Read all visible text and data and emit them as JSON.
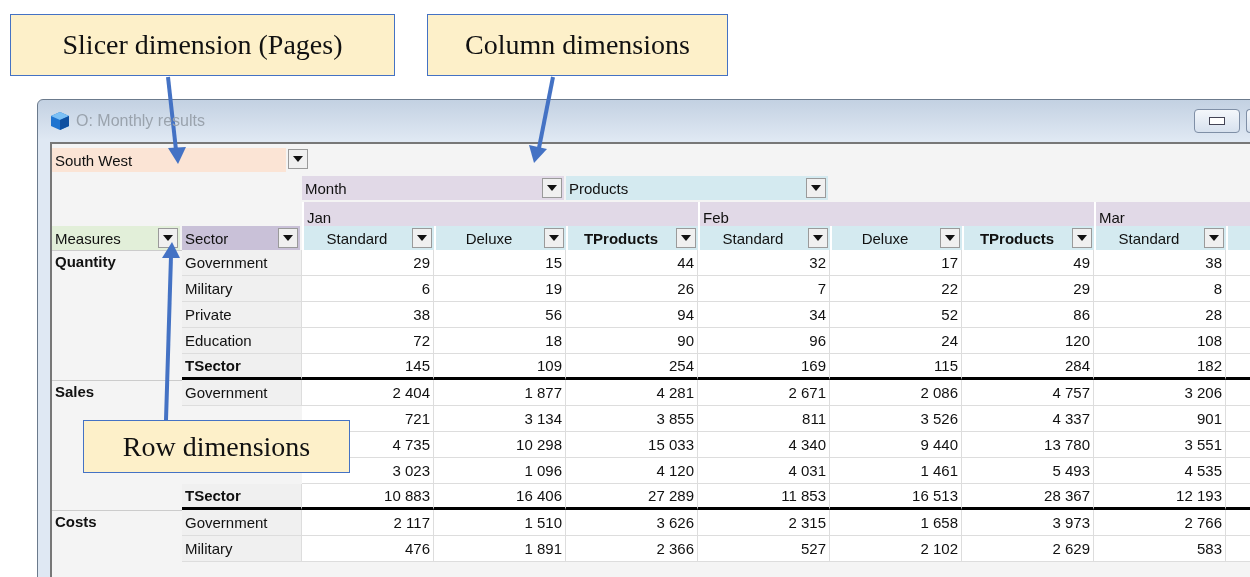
{
  "annotations": [
    {
      "text": "Slicer dimension (Pages)"
    },
    {
      "text": "Column dimensions"
    },
    {
      "text": "Row dimensions"
    }
  ],
  "window": {
    "title": "O: Monthly results"
  },
  "slicer": {
    "label": "South West"
  },
  "column_dimensions": [
    {
      "label": "Month"
    },
    {
      "label": "Products"
    }
  ],
  "row_dimensions": [
    {
      "label": "Measures"
    },
    {
      "label": "Sector"
    }
  ],
  "months": [
    {
      "label": "Jan",
      "columns": [
        {
          "label": "Standard",
          "kind": "member"
        },
        {
          "label": "Deluxe",
          "kind": "member"
        },
        {
          "label": "TProducts",
          "kind": "total"
        }
      ]
    },
    {
      "label": "Feb",
      "columns": [
        {
          "label": "Standard",
          "kind": "member"
        },
        {
          "label": "Deluxe",
          "kind": "member"
        },
        {
          "label": "TProducts",
          "kind": "total"
        }
      ]
    },
    {
      "label": "Mar",
      "columns": [
        {
          "label": "Standard",
          "kind": "member"
        }
      ]
    }
  ],
  "row_groups": [
    {
      "measure": "Quantity",
      "rows": [
        {
          "sector": "Government",
          "kind": "member",
          "values": [
            "29",
            "15",
            "44",
            "32",
            "17",
            "49",
            "38"
          ]
        },
        {
          "sector": "Military",
          "kind": "member",
          "values": [
            "6",
            "19",
            "26",
            "7",
            "22",
            "29",
            "8"
          ]
        },
        {
          "sector": "Private",
          "kind": "member",
          "values": [
            "38",
            "56",
            "94",
            "34",
            "52",
            "86",
            "28"
          ]
        },
        {
          "sector": "Education",
          "kind": "member",
          "values": [
            "72",
            "18",
            "90",
            "96",
            "24",
            "120",
            "108"
          ]
        },
        {
          "sector": "TSector",
          "kind": "total",
          "values": [
            "145",
            "109",
            "254",
            "169",
            "115",
            "284",
            "182"
          ]
        }
      ]
    },
    {
      "measure": "Sales",
      "rows": [
        {
          "sector": "Government",
          "kind": "member",
          "values": [
            "2 404",
            "1 877",
            "4 281",
            "2 671",
            "2 086",
            "4 757",
            "3 206"
          ]
        },
        {
          "kind": "member",
          "values": [
            "721",
            "3 134",
            "3 855",
            "811",
            "3 526",
            "4 337",
            "901"
          ]
        },
        {
          "kind": "member",
          "values": [
            "4 735",
            "10 298",
            "15 033",
            "4 340",
            "9 440",
            "13 780",
            "3 551"
          ]
        },
        {
          "kind": "member",
          "values": [
            "3 023",
            "1 096",
            "4 120",
            "4 031",
            "1 461",
            "5 493",
            "4 535"
          ]
        },
        {
          "sector": "TSector",
          "kind": "total",
          "values": [
            "10 883",
            "16 406",
            "27 289",
            "11 853",
            "16 513",
            "28 367",
            "12 193"
          ]
        }
      ]
    },
    {
      "measure": "Costs",
      "rows": [
        {
          "sector": "Government",
          "kind": "member",
          "values": [
            "2 117",
            "1 510",
            "3 626",
            "2 315",
            "1 658",
            "3 973",
            "2 766"
          ]
        },
        {
          "sector": "Military",
          "kind": "member",
          "values": [
            "476",
            "1 891",
            "2 366",
            "527",
            "2 102",
            "2 629",
            "583"
          ]
        }
      ]
    }
  ]
}
